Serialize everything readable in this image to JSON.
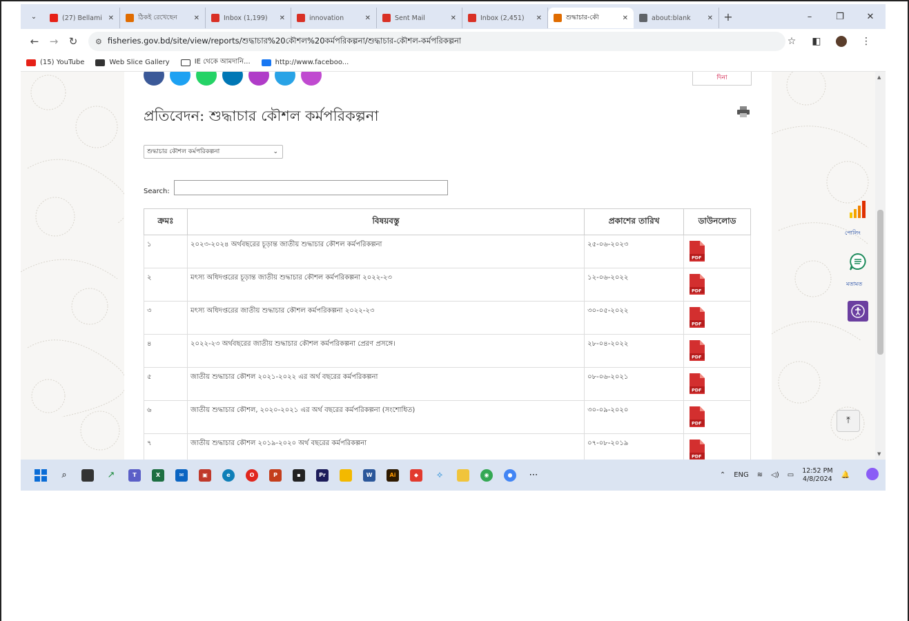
{
  "browser": {
    "tabs": [
      {
        "label": "(27) Bellami",
        "icon_color": "#e62117",
        "active": false
      },
      {
        "label": "ঠিকই রেখেছেন",
        "icon_color": "#e06c00",
        "active": false
      },
      {
        "label": "Inbox (1,199)",
        "icon_color": "#d93025",
        "active": false
      },
      {
        "label": "innovation",
        "icon_color": "#d93025",
        "active": false
      },
      {
        "label": "Sent Mail",
        "icon_color": "#d93025",
        "active": false
      },
      {
        "label": "Inbox (2,451)",
        "icon_color": "#d93025",
        "active": false
      },
      {
        "label": "শুদ্ধাচার-কৌ",
        "icon_color": "#e06c00",
        "active": true
      },
      {
        "label": "about:blank",
        "icon_color": "#5f6368",
        "active": false
      }
    ],
    "url": "fisheries.gov.bd/site/view/reports/শুদ্ধাচার%20কৌশল%20কর্মপরিকল্পনা/শুদ্ধাচার-কৌশল-কর্মপরিকল্পনা",
    "bookmarks": [
      {
        "label": "(15) YouTube",
        "color": "#e62117"
      },
      {
        "label": "Web Slice Gallery",
        "color": "#333333"
      },
      {
        "label": "IE থেকে আমদানি...",
        "color": "#ffffff"
      },
      {
        "label": "http://www.faceboo...",
        "color": "#1877f2"
      }
    ]
  },
  "page": {
    "lang_button": "দিনা",
    "title": "প্রতিবেদন: শুদ্ধাচার কৌশল কর্মপরিকল্পনা",
    "filter_selected": "শুদ্ধাচার কৌশল কর্মপরিকল্পনা",
    "search_label": "Search:",
    "search_value": "",
    "table": {
      "headers": [
        "ক্রমঃ",
        "বিষয়বস্তু",
        "প্রকাশের তারিখ",
        "ডাউনলোড"
      ],
      "rows": [
        {
          "sn": "১",
          "title": "২০২৩-২০২৪ অর্থবছরের চূড়ান্ত জাতীয় শুদ্ধাচার কৌশল কর্মপরিকল্পনা",
          "date": "২৫-০৬-২০২৩"
        },
        {
          "sn": "২",
          "title": "মৎস্য অধিদপ্তরের চূড়ান্ত জাতীয় শুদ্ধাচার কৌশল কর্মপরিকল্পনা ২০২২-২৩",
          "date": "১২-০৬-২০২২"
        },
        {
          "sn": "৩",
          "title": "মৎস্য অধিদপ্তরের জাতীয় শুদ্ধাচার কৌশল কর্মপরিকল্পনা ২০২২-২৩",
          "date": "৩০-০৫-২০২২"
        },
        {
          "sn": "৪",
          "title": "২০২২-২৩ অর্থবছরের জাতীয় শুদ্ধাচার কৌশল কর্মপরিকল্পনা প্রেরণ প্রসঙ্গে।",
          "date": "২৮-০৪-২০২২"
        },
        {
          "sn": "৫",
          "title": "জাতীয় শুদ্ধাচার কৌশল ২০২১-২০২২ এর অর্থ বছরের কর্মপরিকল্পনা",
          "date": "০৮-০৬-২০২১"
        },
        {
          "sn": "৬",
          "title": "জাতীয় শুদ্ধাচার কৌশল, ২০২০-২০২১ এর অর্থ বছরের কর্মপরিকল্পনা (সংশোধিত)",
          "date": "৩০-০৯-২০২০"
        },
        {
          "sn": "৭",
          "title": "জাতীয় শুদ্ধাচার কৌশল ২০১৯-২০২০ অর্থ বছরের কর্মপরিকল্পনা",
          "date": "০৭-০৮-২০১৯"
        }
      ]
    },
    "widgets": {
      "poll_label": "পোলিং",
      "opinion_label": "মতামত"
    }
  },
  "taskbar": {
    "tray_lang": "ENG",
    "time": "12:52 PM",
    "date": "4/8/2024"
  }
}
